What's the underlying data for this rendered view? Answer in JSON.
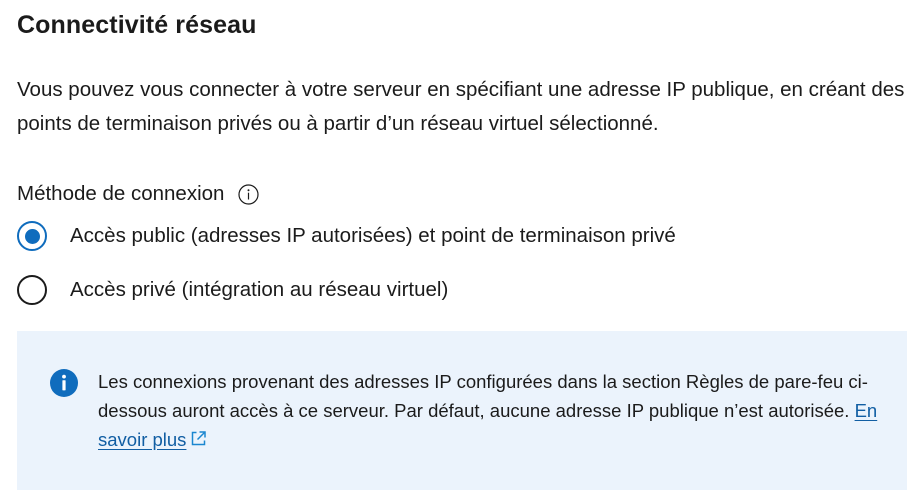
{
  "section": {
    "title": "Connectivité réseau",
    "description": "Vous pouvez vous connecter à votre serveur en spécifiant une adresse IP publique, en créant des points de terminaison privés ou à partir d’un réseau virtuel sélectionné."
  },
  "connection_method": {
    "label": "Méthode de connexion",
    "info_icon": "info-circle-icon",
    "options": [
      {
        "label": "Accès public (adresses IP autorisées) et point de terminaison privé",
        "selected": true
      },
      {
        "label": "Accès privé (intégration au réseau virtuel)",
        "selected": false
      }
    ]
  },
  "info_box": {
    "icon": "info-filled-icon",
    "text": "Les connexions provenant des adresses IP configurées dans la section Règles de pare-feu ci-dessous auront accès à ce serveur. Par défaut, aucune adresse IP publique n’est autorisée.",
    "link_label": "En savoir plus",
    "link_icon": "external-link-icon"
  },
  "colors": {
    "accent": "#0f6cbd",
    "link": "#115ea3",
    "info_bg": "#ebf3fc",
    "text": "#1b1b1b"
  }
}
